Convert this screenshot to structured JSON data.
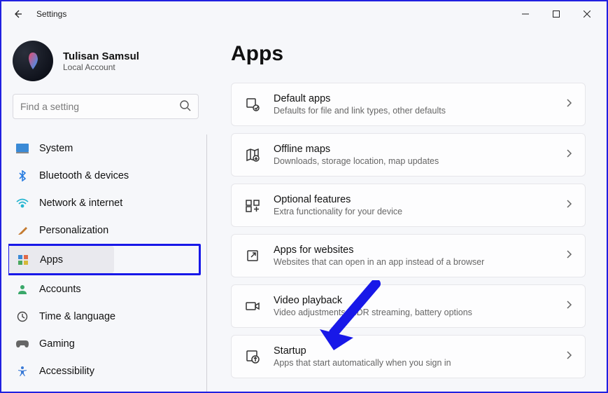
{
  "window": {
    "title": "Settings"
  },
  "profile": {
    "name": "Tulisan Samsul",
    "account_type": "Local Account"
  },
  "search": {
    "placeholder": "Find a setting"
  },
  "nav": {
    "items": [
      {
        "key": "system",
        "label": "System"
      },
      {
        "key": "bluetooth",
        "label": "Bluetooth & devices"
      },
      {
        "key": "network",
        "label": "Network & internet"
      },
      {
        "key": "personalization",
        "label": "Personalization"
      },
      {
        "key": "apps",
        "label": "Apps",
        "selected": true
      },
      {
        "key": "accounts",
        "label": "Accounts"
      },
      {
        "key": "time",
        "label": "Time & language"
      },
      {
        "key": "gaming",
        "label": "Gaming"
      },
      {
        "key": "accessibility",
        "label": "Accessibility"
      }
    ]
  },
  "page": {
    "title": "Apps",
    "items": [
      {
        "key": "default-apps",
        "title": "Default apps",
        "subtitle": "Defaults for file and link types, other defaults"
      },
      {
        "key": "offline-maps",
        "title": "Offline maps",
        "subtitle": "Downloads, storage location, map updates"
      },
      {
        "key": "optional-features",
        "title": "Optional features",
        "subtitle": "Extra functionality for your device"
      },
      {
        "key": "apps-for-websites",
        "title": "Apps for websites",
        "subtitle": "Websites that can open in an app instead of a browser"
      },
      {
        "key": "video-playback",
        "title": "Video playback",
        "subtitle": "Video adjustments, HDR streaming, battery options"
      },
      {
        "key": "startup",
        "title": "Startup",
        "subtitle": "Apps that start automatically when you sign in"
      }
    ]
  },
  "colors": {
    "accent": "#1818e8"
  }
}
